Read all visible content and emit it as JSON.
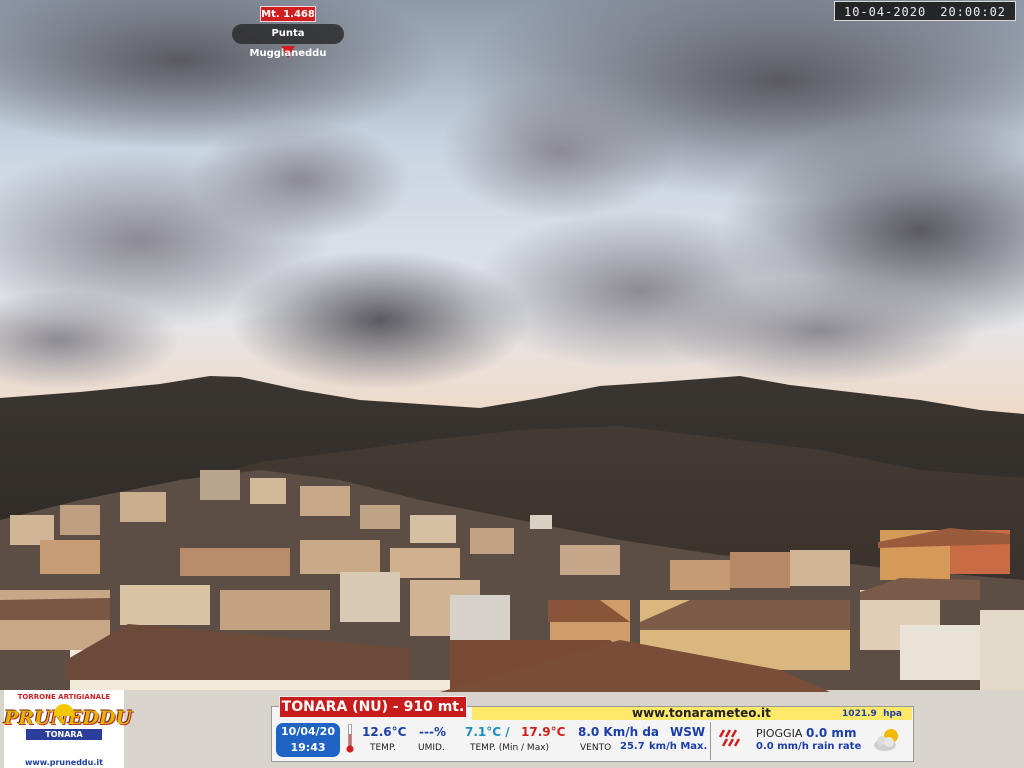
{
  "camera": {
    "timestamp_date": "10-04-2020",
    "timestamp_time": "20:00:02"
  },
  "peak_marker": {
    "altitude": "Mt. 1.468",
    "name": "Punta Muggianeddu",
    "icon": "location-pin-icon"
  },
  "sponsor": {
    "tagline": "TORRONE ARTIGIANALE",
    "brand": "PRUNEDDU",
    "place": "TONARA",
    "url": "www.pruneddu.it"
  },
  "weather": {
    "station": "TONARA (NU) - 910 mt.",
    "website": "www.tonarameteo.it",
    "pressure_value": "1021.9",
    "pressure_unit": "hpa",
    "date": "10/04/20",
    "time": "19:43",
    "temperature": "12.6°C",
    "temperature_label": "TEMP.",
    "humidity": "---%",
    "humidity_label": "UMID.",
    "temp_min": "7.1°C /",
    "temp_max": "17.9°C",
    "temp_minmax_label": "TEMP. (Min / Max)",
    "wind_speed": "8.0 Km/h da",
    "wind_direction": "WSW",
    "wind_label": "VENTO",
    "wind_max_value": "25.7",
    "wind_max_unit": "km/h Max.",
    "rain_label": "PIOGGIA",
    "rain_value": "0.0 mm",
    "rain_rate": "0.0 mm/h rain rate",
    "thermometer_icon": "thermometer-icon",
    "rain_icon": "rain-icon",
    "condition_icon": "partly-cloudy-icon"
  },
  "colors": {
    "accent_red": "#c81b1b",
    "panel_blue": "#1f63c4",
    "value_blue": "#1b3da8",
    "url_yellow": "#ffe96b"
  }
}
